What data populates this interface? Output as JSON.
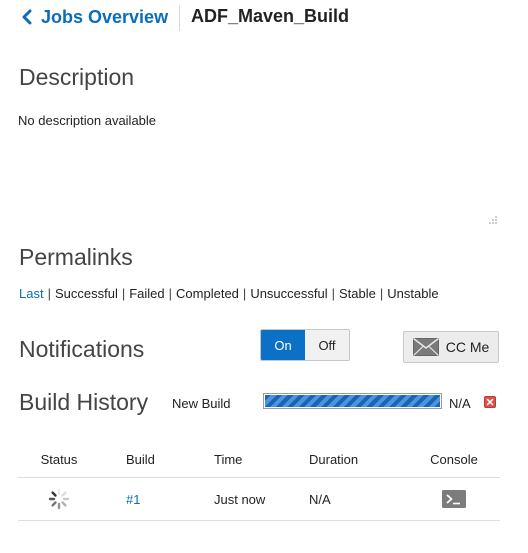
{
  "header": {
    "back_label": "Jobs Overview",
    "job_name": "ADF_Maven_Build"
  },
  "description": {
    "title": "Description",
    "text": "No description available"
  },
  "permalinks": {
    "title": "Permalinks",
    "links": [
      "Last",
      "Successful",
      "Failed",
      "Completed",
      "Unsuccessful",
      "Stable",
      "Unstable"
    ]
  },
  "notifications": {
    "title": "Notifications",
    "on_label": "On",
    "off_label": "Off",
    "cc_label": "CC Me"
  },
  "build_history": {
    "title": "Build History",
    "new_build_label": "New Build",
    "progress_text": "N/A",
    "progress_fraction": 1.0,
    "columns": [
      "Status",
      "Build",
      "Time",
      "Duration",
      "Console"
    ],
    "rows": [
      {
        "status_icon": "spinner-icon",
        "build": "#1",
        "time": "Just now",
        "duration": "N/A",
        "console_icon": "terminal-icon"
      }
    ]
  },
  "colors": {
    "accent": "#0a6cbd",
    "toggle_on": "#0a71c7",
    "progress_stripe": "#1b63b5",
    "cancel_red": "#d9534f"
  }
}
